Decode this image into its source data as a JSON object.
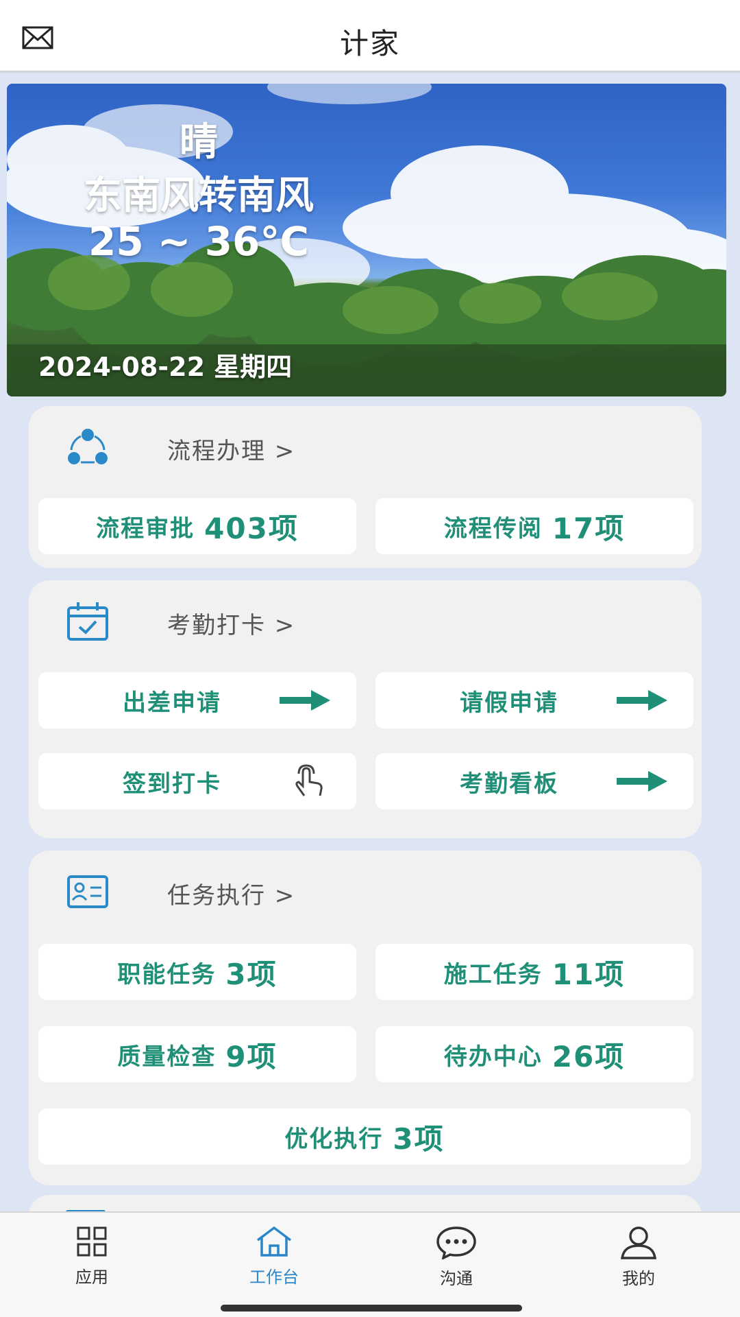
{
  "header": {
    "title": "计家",
    "mail_icon": "mail-icon"
  },
  "weather": {
    "condition": "晴",
    "wind": "东南风转南风",
    "temperature": "25 ~ 36°C",
    "date": "2024-08-22 星期四"
  },
  "process": {
    "title": "流程办理 >",
    "icon": "share-nodes-icon",
    "items": [
      {
        "label": "流程审批",
        "count": "403项"
      },
      {
        "label": "流程传阅",
        "count": "17项"
      }
    ]
  },
  "attendance": {
    "title": "考勤打卡 >",
    "icon": "calendar-check-icon",
    "items": [
      {
        "label": "出差申请",
        "icon": "arrow-right-icon"
      },
      {
        "label": "请假申请",
        "icon": "arrow-right-icon"
      },
      {
        "label": "签到打卡",
        "icon": "touch-icon"
      },
      {
        "label": "考勤看板",
        "icon": "arrow-right-icon"
      }
    ]
  },
  "tasks": {
    "title": "任务执行 >",
    "icon": "id-card-icon",
    "items": [
      {
        "label": "职能任务",
        "count": "3项"
      },
      {
        "label": "施工任务",
        "count": "11项"
      },
      {
        "label": "质量检查",
        "count": "9项"
      },
      {
        "label": "待办中心",
        "count": "26项"
      },
      {
        "label": "优化执行",
        "count": "3项"
      }
    ]
  },
  "nav": {
    "items": [
      {
        "label": "应用",
        "icon": "grid-icon"
      },
      {
        "label": "工作台",
        "icon": "home-icon",
        "active": true
      },
      {
        "label": "沟通",
        "icon": "chat-icon"
      },
      {
        "label": "我的",
        "icon": "user-icon"
      }
    ]
  },
  "colors": {
    "accent": "#1f8f78",
    "nav_active": "#2a86c9",
    "icon_blue": "#2a8ac8"
  }
}
